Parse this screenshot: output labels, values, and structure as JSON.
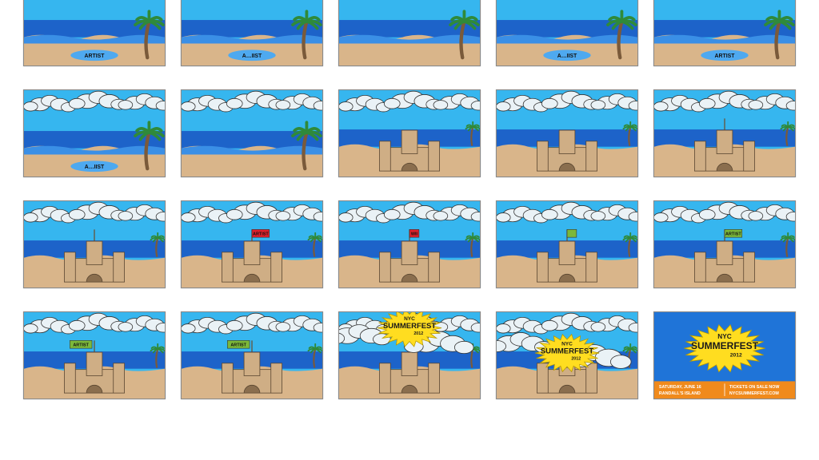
{
  "colors": {
    "sky": "#36b6ef",
    "sea": "#1d63c9",
    "sea_light": "#3a8fe6",
    "sand": "#d9b58a",
    "cloud": "#eaf2f6",
    "palm_leaf": "#2f8a3a",
    "trunk": "#7a5a3a",
    "castle": "#cfae85",
    "flag_red": "#e0202a",
    "flag_green": "#7bb83a",
    "burst": "#ffdd20",
    "poster_bg": "#1f74d8",
    "poster_footer": "#f08a1c"
  },
  "frames": [
    {
      "id": 1,
      "scene": "beach-wave",
      "wave_text": "ARTIST"
    },
    {
      "id": 2,
      "scene": "beach-wave",
      "wave_text": "A…IIST"
    },
    {
      "id": 3,
      "scene": "beach-wave",
      "wave_text": ""
    },
    {
      "id": 4,
      "scene": "beach-wave",
      "wave_text": "A…IIST"
    },
    {
      "id": 5,
      "scene": "beach-wave",
      "wave_text": "ARTIST"
    },
    {
      "id": 6,
      "scene": "beach-wave",
      "wave_text": "A…IIST"
    },
    {
      "id": 7,
      "scene": "beach-wave",
      "wave_text": ""
    },
    {
      "id": 8,
      "scene": "castle",
      "flag": "none"
    },
    {
      "id": 9,
      "scene": "castle",
      "flag": "none"
    },
    {
      "id": 10,
      "scene": "castle",
      "flag": "pole"
    },
    {
      "id": 11,
      "scene": "castle",
      "flag": "pole"
    },
    {
      "id": 12,
      "scene": "castle",
      "flag": "red",
      "flag_text": "ARTIST"
    },
    {
      "id": 13,
      "scene": "castle",
      "flag": "red-small",
      "flag_text": "WII"
    },
    {
      "id": 14,
      "scene": "castle",
      "flag": "green-small",
      "flag_text": ""
    },
    {
      "id": 15,
      "scene": "castle",
      "flag": "green",
      "flag_text": "ARTIST"
    },
    {
      "id": 16,
      "scene": "castle",
      "flag": "green-big",
      "flag_text": "ARTIST"
    },
    {
      "id": 17,
      "scene": "castle",
      "flag": "green-big",
      "flag_text": "ARTIST"
    },
    {
      "id": 18,
      "scene": "burst-top",
      "burst_top": "NYC",
      "burst_main": "SUMMERFEST",
      "burst_year": "2012"
    },
    {
      "id": 19,
      "scene": "burst-center",
      "burst_top": "NYC",
      "burst_main": "SUMMERFEST",
      "burst_year": "2012"
    },
    {
      "id": 20,
      "scene": "poster",
      "burst_top": "NYC",
      "burst_main": "SUMMERFEST",
      "burst_year": "2012",
      "footer_left_1": "SATURDAY, JUNE 16",
      "footer_left_2": "RANDALL'S ISLAND",
      "footer_right_1": "TICKETS ON SALE NOW",
      "footer_right_2": "NYCSUMMERFEST.COM"
    }
  ]
}
